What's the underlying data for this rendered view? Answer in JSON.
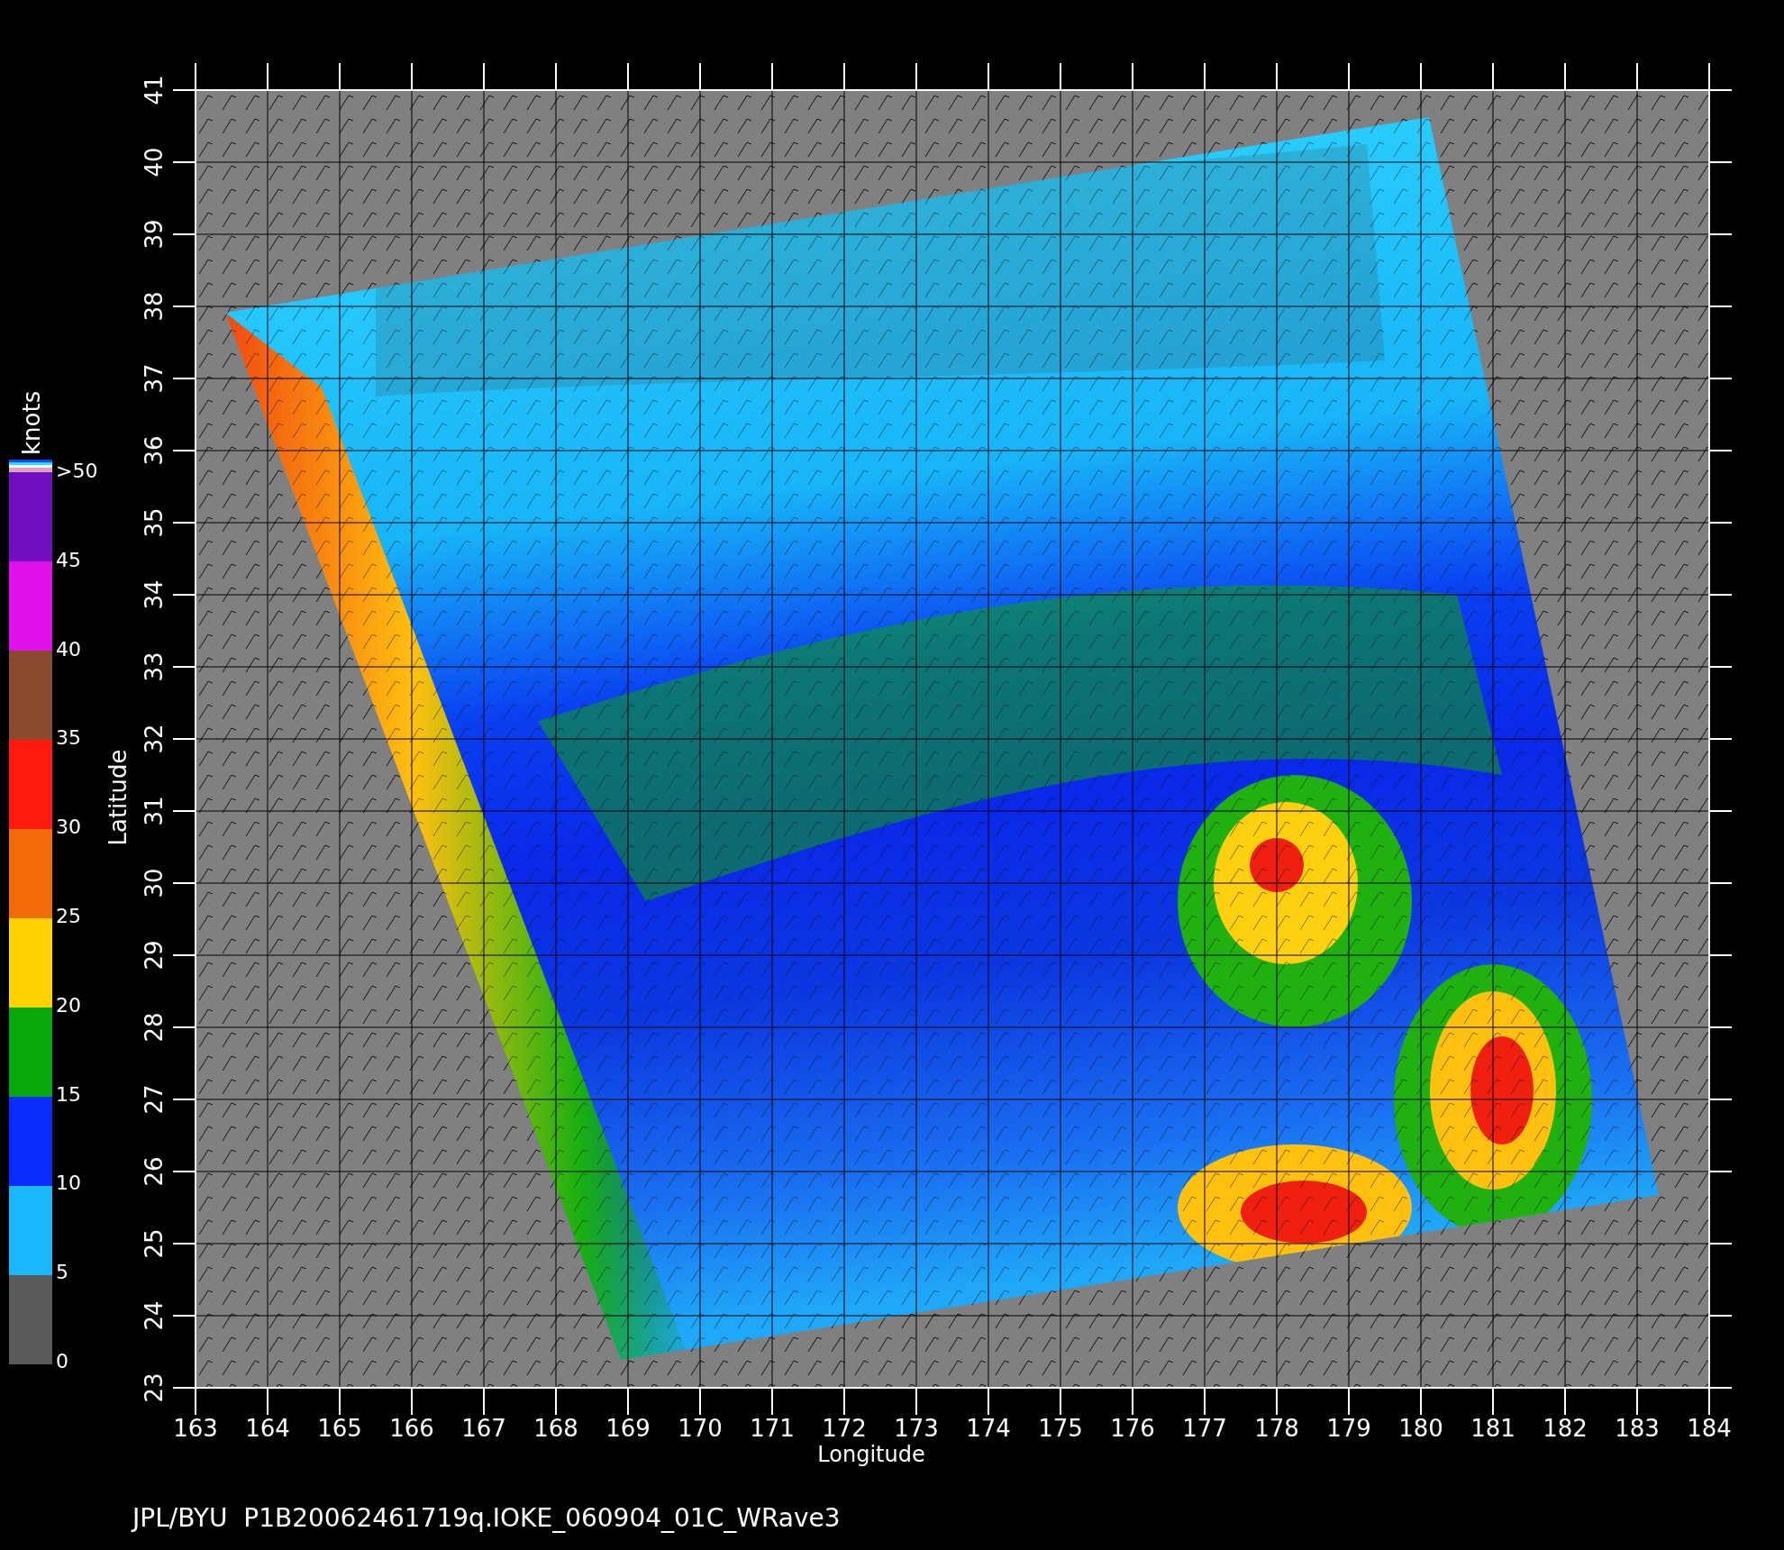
{
  "colorbar": {
    "unit": "knots",
    "segments": [
      {
        "color": "#7010c0"
      },
      {
        "color": "#e010e8"
      },
      {
        "color": "#8a4a30"
      },
      {
        "color": "#ff1a10"
      },
      {
        "color": "#f26a0a"
      },
      {
        "color": "#ffd200"
      },
      {
        "color": "#06a80a"
      },
      {
        "color": "#0a2cff"
      },
      {
        "color": "#1ab8ff"
      },
      {
        "color": "#5a5a5a"
      }
    ],
    "labels": [
      ">50",
      "45",
      "40",
      "35",
      "30",
      "25",
      "20",
      "15",
      "10",
      "5",
      "0"
    ]
  },
  "plot": {
    "ylabel": "Latitude",
    "xlabel": "Longitude",
    "yticks": [
      "41",
      "40",
      "39",
      "38",
      "37",
      "36",
      "35",
      "34",
      "33",
      "32",
      "31",
      "30",
      "29",
      "28",
      "27",
      "26",
      "25",
      "24",
      "23"
    ],
    "xticks": [
      "163",
      "164",
      "165",
      "166",
      "167",
      "168",
      "169",
      "170",
      "171",
      "172",
      "173",
      "174",
      "175",
      "176",
      "177",
      "178",
      "179",
      "180",
      "181",
      "182",
      "183",
      "184"
    ]
  },
  "footer": "JPL/BYU  P1B20062461719q.IOKE_060904_01C_WRave3"
}
